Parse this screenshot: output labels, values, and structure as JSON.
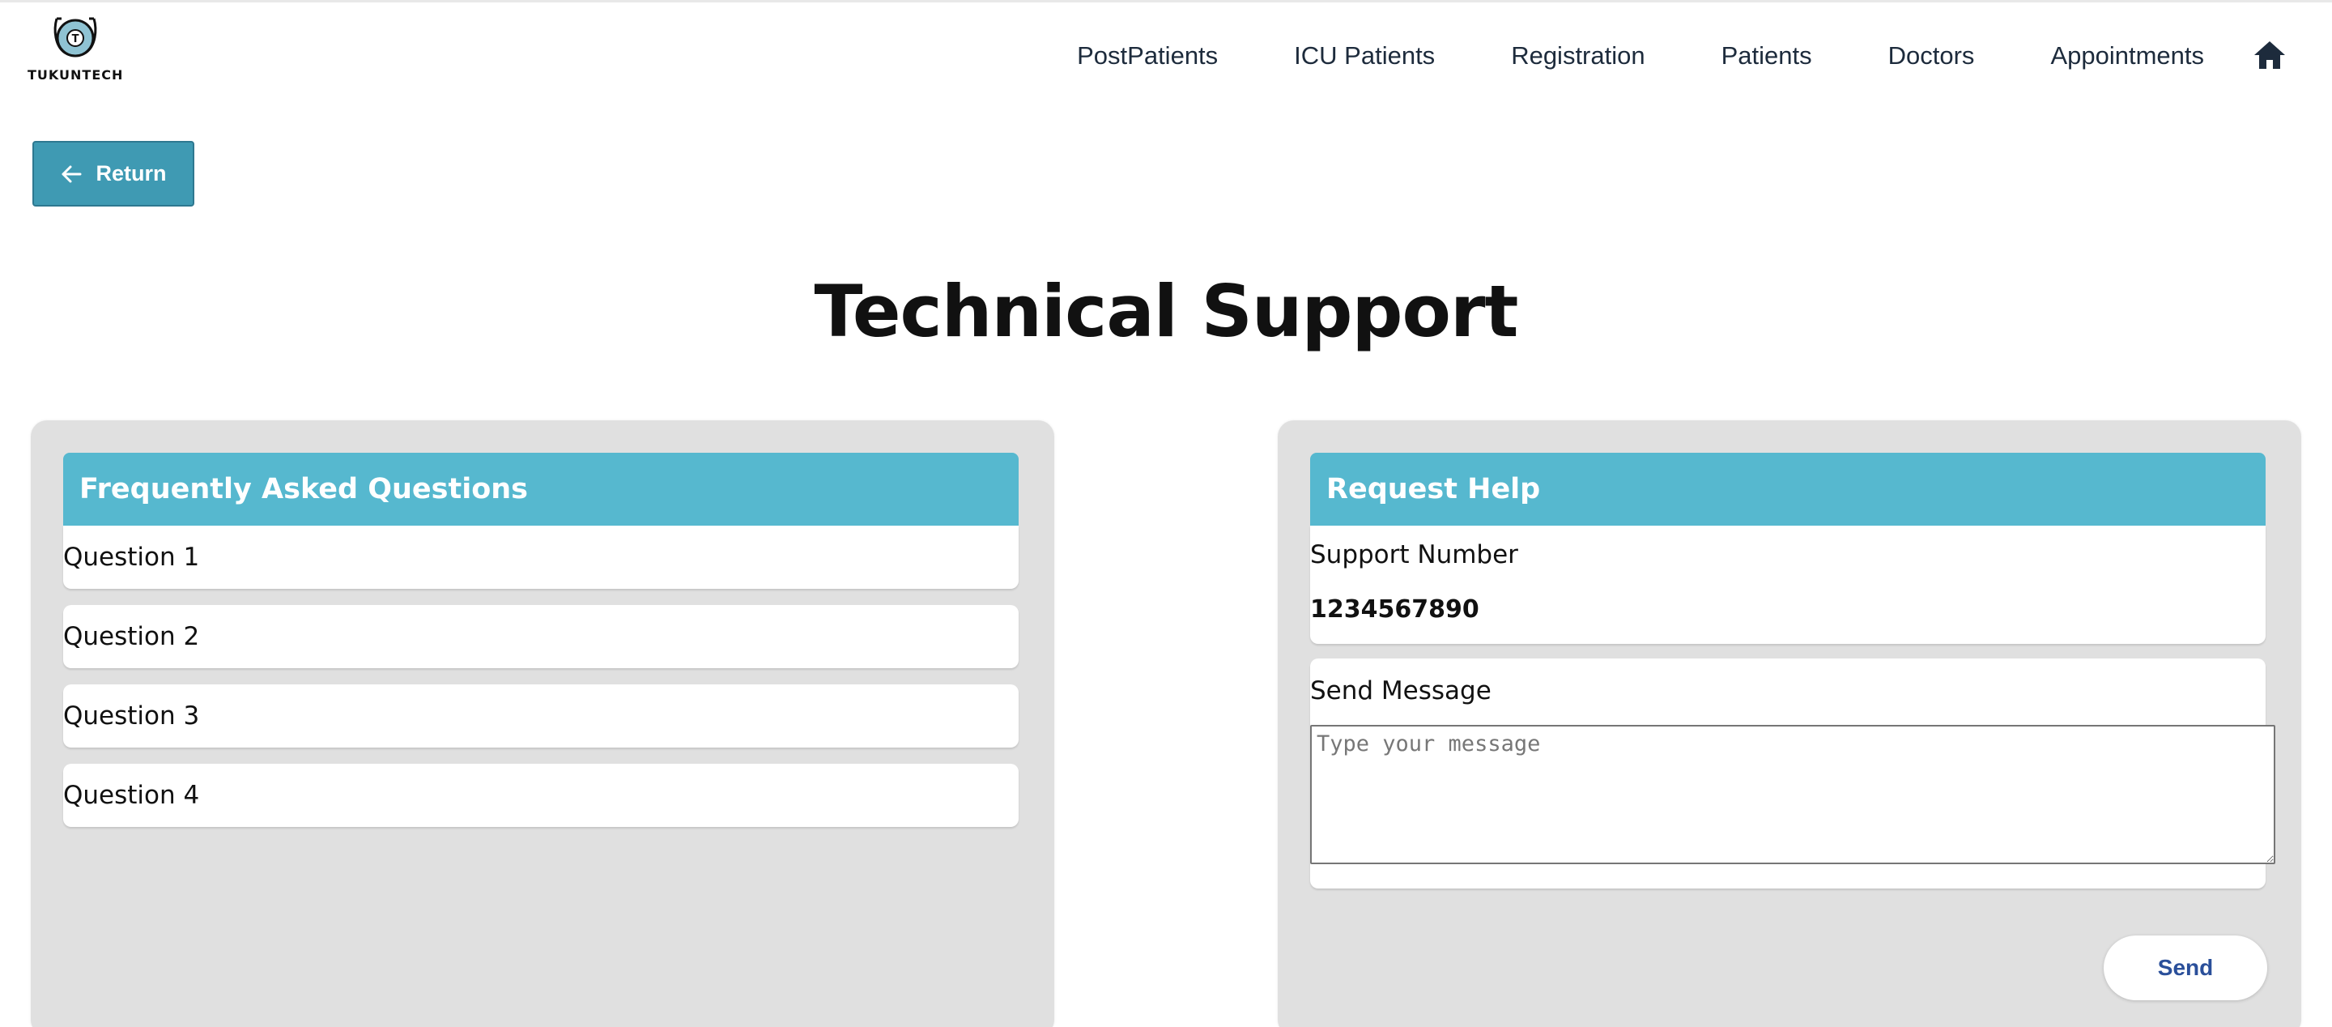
{
  "header": {
    "logo_text": "TUKUNTECH",
    "logo_badge": "T",
    "nav": [
      {
        "label": "PostPatients"
      },
      {
        "label": "ICU Patients"
      },
      {
        "label": "Registration"
      },
      {
        "label": "Patients"
      },
      {
        "label": "Doctors"
      },
      {
        "label": "Appointments"
      }
    ],
    "home_icon": "home-icon"
  },
  "return_button": {
    "label": "Return",
    "icon": "arrow-left-icon"
  },
  "page_title": "Technical Support",
  "faq": {
    "title": "Frequently Asked Questions",
    "questions": [
      "Question 1",
      "Question 2",
      "Question 3",
      "Question 4"
    ]
  },
  "help": {
    "title": "Request Help",
    "support_label": "Support Number",
    "support_number": "1234567890",
    "message_label": "Send Message",
    "message_placeholder": "Type your message",
    "message_value": "",
    "send_label": "Send"
  },
  "colors": {
    "accent": "#56b8cf",
    "return_button": "#3f9ab3",
    "panel_bg": "#e0e0e0",
    "nav_text": "#1d2b3c",
    "send_text": "#2a4f9a"
  }
}
